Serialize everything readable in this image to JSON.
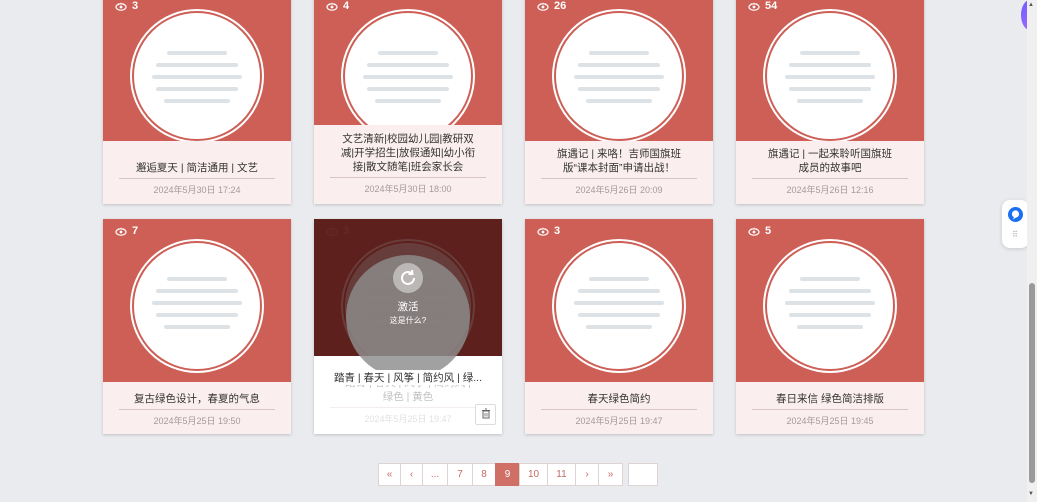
{
  "cards": [
    {
      "views": "3",
      "title": "邂逅夏天 | 简洁通用 | 文艺",
      "date": "2024年5月30日 17:24"
    },
    {
      "views": "4",
      "title": "文艺清新|校园幼儿园|教研双减|开学招生|放假通知|幼小衔接|散文随笔|班会家长会",
      "date": "2024年5月30日 18:00"
    },
    {
      "views": "26",
      "title": "旗遇记 | 来咯！吉师国旗班版“课本封面”申请出战！",
      "date": "2024年5月26日 20:09"
    },
    {
      "views": "54",
      "title": "旗遇记 | 一起来聆听国旗班成员的故事吧",
      "date": "2024年5月26日 12:16"
    },
    {
      "views": "7",
      "title": "复古绿色设计，春夏的气息",
      "date": "2024年5月25日 19:50"
    },
    {
      "views": "3",
      "title": "踏青 | 春天 | 风筝 | 简约风 | 绿色 | 黄色",
      "date": "2024年5月25日 19:47",
      "hover_title": "踏青 | 春天 | 风筝 | 简约风 | 绿...",
      "activate_label": "激活",
      "activate_hint": "这是什么?"
    },
    {
      "views": "3",
      "title": "春天绿色简约",
      "date": "2024年5月25日 19:47"
    },
    {
      "views": "5",
      "title": "春日来信 绿色简洁排版",
      "date": "2024年5月25日 19:45"
    }
  ],
  "pagination": {
    "first": "«",
    "prev": "‹",
    "ellipsis": "...",
    "pages": [
      "7",
      "8",
      "9",
      "10",
      "11"
    ],
    "current": "9",
    "next": "›",
    "last": "»"
  },
  "colors": {
    "accent": "#cd5f56",
    "card_bg": "#fbeeee",
    "page_bg": "#e9ebee"
  },
  "icons": {
    "views": "eye-icon",
    "activate": "refresh-icon",
    "delete": "trash-icon"
  }
}
